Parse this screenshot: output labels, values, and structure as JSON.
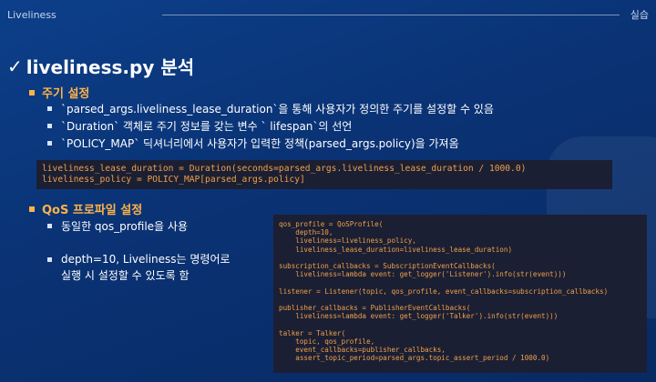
{
  "header": {
    "left": "Liveliness",
    "right": "실습"
  },
  "title": {
    "check": "✓",
    "text": "liveliness.py 분석"
  },
  "sections": {
    "s1": {
      "heading": "주기 설정",
      "items": [
        "`parsed_args.liveliness_lease_duration`을 통해 사용자가 정의한 주기를 설정할 수 있음",
        "`Duration` 객체로 주기 정보를 갖는 변수 ` lifespan`의 선언",
        "`POLICY_MAP` 딕셔너리에서 사용자가 입력한 정책(parsed_args.policy)을 가져옴"
      ]
    },
    "s2": {
      "heading": "QoS 프로파일 설정",
      "items": [
        "동일한 qos_profile을 사용",
        "depth=10, Liveliness는 명령어로",
        "실행 시 설정할 수 있도록 함"
      ]
    }
  },
  "code1": [
    "liveliness_lease_duration = Duration(seconds=parsed_args.liveliness_lease_duration / 1000.0)",
    "liveliness_policy = POLICY_MAP[parsed_args.policy]"
  ],
  "code2": [
    "qos_profile = QoSProfile(",
    "    depth=10,",
    "    liveliness=liveliness_policy,",
    "    liveliness_lease_duration=liveliness_lease_duration)",
    "",
    "subscription_callbacks = SubscriptionEventCallbacks(",
    "    liveliness=lambda event: get_logger('Listener').info(str(event)))",
    "",
    "listener = Listener(topic, qos_profile, event_callbacks=subscription_callbacks)",
    "",
    "publisher_callbacks = PublisherEventCallbacks(",
    "    liveliness=lambda event: get_logger('Talker').info(str(event)))",
    "",
    "talker = Talker(",
    "    topic, qos_profile,",
    "    event_callbacks=publisher_callbacks,",
    "    assert_topic_period=parsed_args.topic_assert_period / 1000.0)"
  ]
}
